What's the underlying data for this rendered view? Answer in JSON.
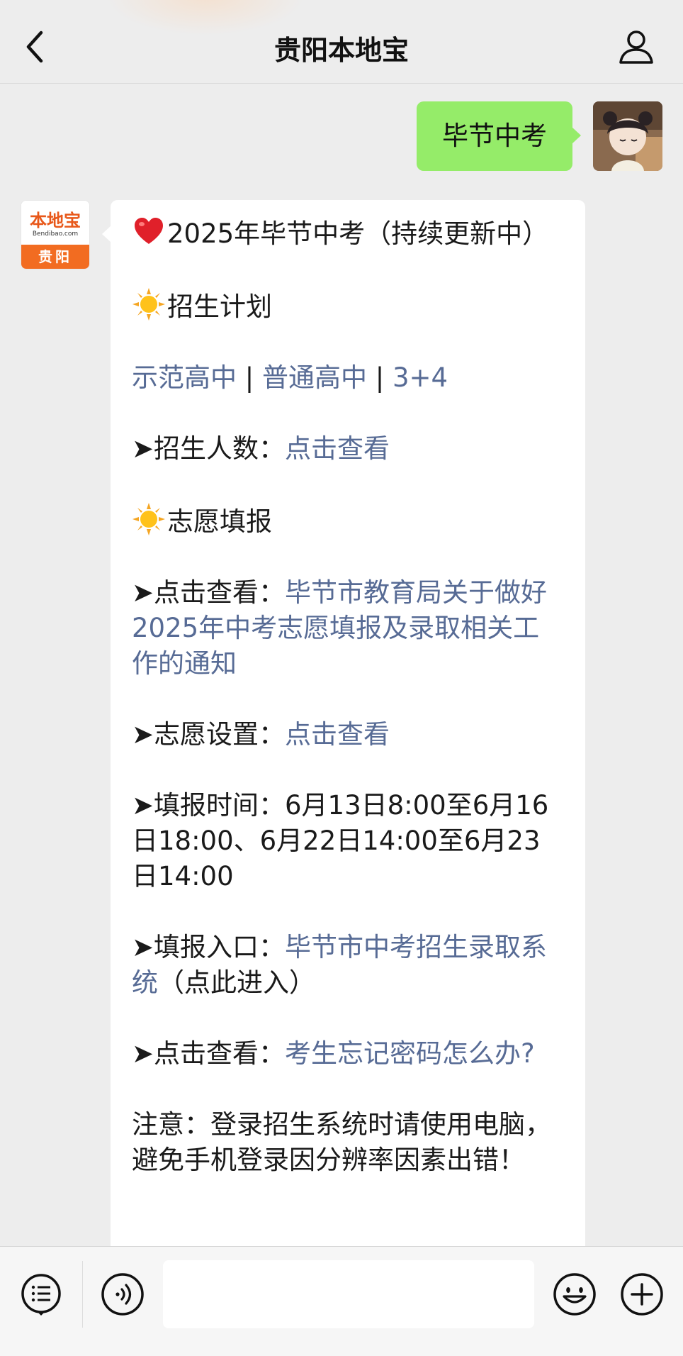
{
  "header": {
    "title": "贵阳本地宝"
  },
  "chat": {
    "user_message": "毕节中考",
    "bot_avatar": {
      "logo_text": "本地宝",
      "logo_sub": "Bendibao.com",
      "city": "贵阳"
    },
    "bot_message": {
      "headline": "2025年毕节中考（持续更新中）",
      "section1_title": "招生计划",
      "links_row": [
        "示范高中",
        "普通高中",
        "3+4"
      ],
      "links_sep": " | ",
      "enroll_count_label": "➤招生人数：",
      "enroll_count_link": "点击查看",
      "section2_title": "志愿填报",
      "notice_label": "➤点击查看：",
      "notice_link": "毕节市教育局关于做好2025年中考志愿填报及录取相关工作的通知",
      "setting_label": "➤志愿设置：",
      "setting_link": "点击查看",
      "time_label": "➤填报时间：",
      "time_value": "6月13日8:00至6月16日18:00、6月22日14:00至6月23日14:00",
      "entry_label": "➤填报入口：",
      "entry_link": "毕节市中考招生录取系统",
      "entry_suffix": "（点此进入）",
      "password_label": "➤点击查看：",
      "password_link": "考生忘记密码怎么办?",
      "note": "注意：登录招生系统时请使用电脑，避免手机登录因分辨率因素出错！"
    }
  },
  "input_bar": {
    "placeholder": ""
  },
  "colors": {
    "user_bubble": "#95ec69",
    "link": "#576b95",
    "brand_orange": "#f26c21"
  },
  "icons": [
    "back-icon",
    "profile-icon",
    "menu-list-icon",
    "voice-icon",
    "emoji-icon",
    "plus-icon",
    "heart-icon",
    "sun-icon"
  ]
}
